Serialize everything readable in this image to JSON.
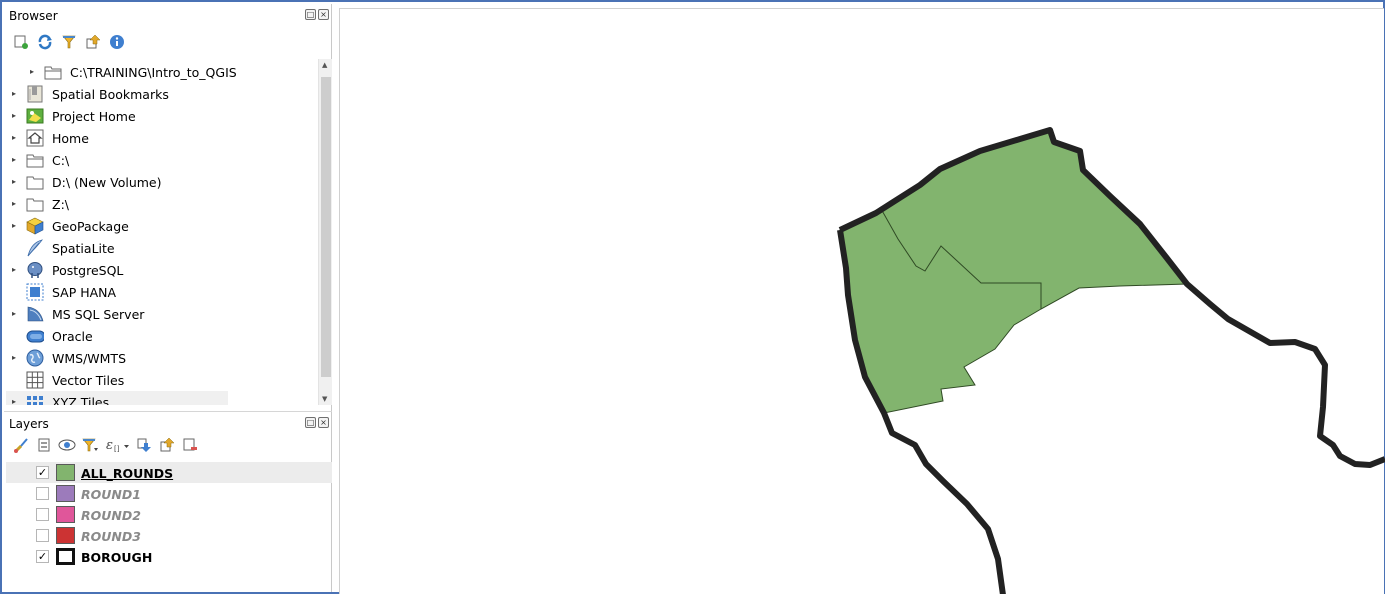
{
  "browser": {
    "title": "Browser",
    "toolbar": [
      {
        "icon": "add-layer-icon"
      },
      {
        "icon": "refresh-icon"
      },
      {
        "icon": "filter-icon"
      },
      {
        "icon": "collapse-all-icon"
      },
      {
        "icon": "info-icon"
      }
    ],
    "items": [
      {
        "label": "C:\\TRAINING\\Intro_to_QGIS",
        "icon": "folder-icon",
        "expandable": true
      },
      {
        "label": "Spatial Bookmarks",
        "icon": "bookmarks-icon",
        "expandable": true
      },
      {
        "label": "Project Home",
        "icon": "project-home-icon",
        "expandable": true
      },
      {
        "label": "Home",
        "icon": "home-icon",
        "expandable": true
      },
      {
        "label": "C:\\",
        "icon": "drive-icon",
        "expandable": true
      },
      {
        "label": "D:\\ (New Volume)",
        "icon": "folder-icon",
        "expandable": true
      },
      {
        "label": "Z:\\",
        "icon": "folder-icon",
        "expandable": true
      },
      {
        "label": "GeoPackage",
        "icon": "geopackage-icon",
        "expandable": true
      },
      {
        "label": "SpatiaLite",
        "icon": "spatialite-feather-icon",
        "expandable": false
      },
      {
        "label": "PostgreSQL",
        "icon": "postgresql-elephant-icon",
        "expandable": true
      },
      {
        "label": "SAP HANA",
        "icon": "sap-hana-icon",
        "expandable": false
      },
      {
        "label": "MS SQL Server",
        "icon": "mssql-icon",
        "expandable": true
      },
      {
        "label": "Oracle",
        "icon": "oracle-icon",
        "expandable": false
      },
      {
        "label": "WMS/WMTS",
        "icon": "globe-icon",
        "expandable": true
      },
      {
        "label": "Vector Tiles",
        "icon": "vector-tiles-icon",
        "expandable": false
      },
      {
        "label": "XYZ Tiles",
        "icon": "xyz-tiles-icon",
        "expandable": true
      }
    ]
  },
  "layers": {
    "title": "Layers",
    "toolbar": [
      {
        "icon": "style-brush-icon"
      },
      {
        "icon": "add-group-icon"
      },
      {
        "icon": "visibility-eye-icon"
      },
      {
        "icon": "filter-legend-icon"
      },
      {
        "icon": "expression-filter-icon"
      },
      {
        "icon": "expand-all-icon"
      },
      {
        "icon": "collapse-all-icon"
      },
      {
        "icon": "remove-layer-icon"
      }
    ],
    "items": [
      {
        "name": "ALL_ROUNDS",
        "checked": true,
        "color": "#82b46e",
        "selected": true,
        "active": true
      },
      {
        "name": "ROUND1",
        "checked": false,
        "color": "#9c7bbb",
        "selected": false,
        "active": false
      },
      {
        "name": "ROUND2",
        "checked": false,
        "color": "#e0569a",
        "selected": false,
        "active": false
      },
      {
        "name": "ROUND3",
        "checked": false,
        "color": "#cc3333",
        "selected": false,
        "active": false
      },
      {
        "name": "BOROUGH",
        "checked": true,
        "color": "#ffffff",
        "selected": false,
        "active": true,
        "outline": true
      }
    ]
  },
  "map": {
    "fill_color": "#82b46e",
    "boundary_color": "#222222"
  },
  "colors": {
    "accent": "#4a72b5"
  }
}
